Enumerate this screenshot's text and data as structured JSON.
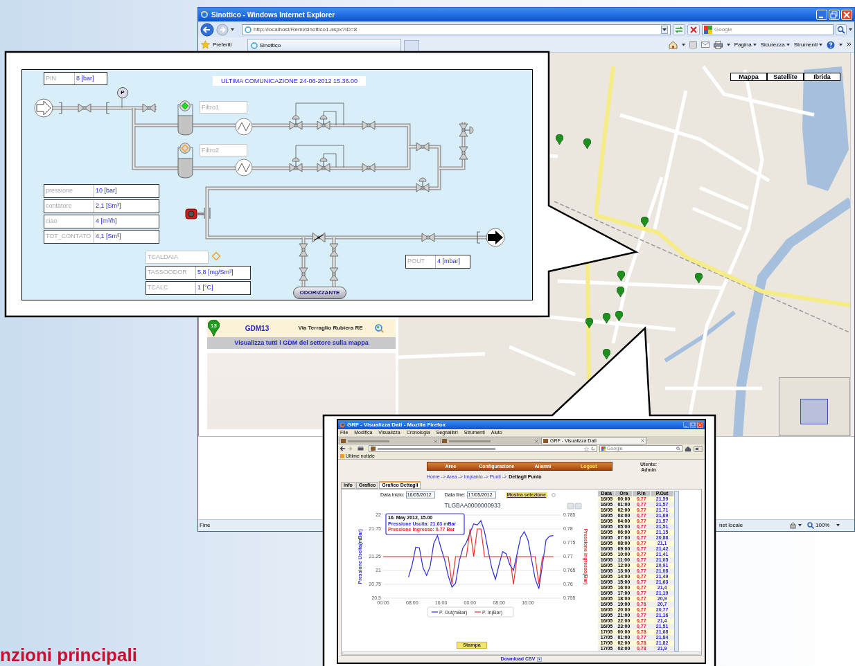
{
  "slide": {
    "heading": "nzioni principali"
  },
  "ie": {
    "title": "Sinottico - Windows Internet Explorer",
    "url": "http://localhost/Remi/sinottico1.aspx?ID=8",
    "search_placeholder": "Google",
    "favorites": "Preferiti",
    "tab": "Sinottico",
    "toolbar": [
      "Pagina",
      "Sicurezza",
      "Strumenti"
    ],
    "status": "Fine",
    "zone": "net locale",
    "zoom": "100%"
  },
  "map": {
    "types": [
      {
        "label": "Mappa"
      },
      {
        "label": "Satellite"
      },
      {
        "label": "Ibrida"
      }
    ]
  },
  "gdm_list": {
    "rows": [
      {
        "marker_number": "13",
        "name": "GDM13",
        "address": "Via Terraglio Rubiera RE"
      }
    ],
    "show_all": "Visualizza tutti i GDM del settore sulla mappa"
  },
  "synoptic": {
    "last_communication": "ULTIMA COMUNICAZIONE 24-06-2012 15.36.00",
    "inlet": {
      "label": "PIN",
      "value": "8 [bar]"
    },
    "gauge": "P",
    "filters": [
      {
        "label": "Filtro1",
        "alarm": false
      },
      {
        "label": "Filtro2",
        "alarm": true
      }
    ],
    "measurements": [
      {
        "label": "pressione",
        "value": "10 [bar]"
      },
      {
        "label": "contatore",
        "value": "2,1 [Sm³]"
      },
      {
        "label": "ciao",
        "value": "4 [m³/h]"
      },
      {
        "label": "TOT_CONTATO",
        "value": "4,1 [Sm³]"
      }
    ],
    "boiler": {
      "label": "TCALDAIA",
      "alarm": true
    },
    "odorant_readings": [
      {
        "label": "TASSOODOR",
        "value": "5,8 [mg/Sm³]"
      },
      {
        "label": "TCALC",
        "value": "1 [°C]"
      }
    ],
    "outlet": {
      "label": "POUT",
      "value": "4 [mbar]"
    },
    "odorizer": "ODORIZZANTE"
  },
  "firefox": {
    "title": "GRF - Visualizza Dati - Mozilla Firefox",
    "menu": [
      "File",
      "Modifica",
      "Visualizza",
      "Cronologia",
      "Segnalibri",
      "Strumenti",
      "Aiuto"
    ],
    "tabs": [
      {
        "selected": false
      },
      {
        "selected": false
      },
      {
        "label": "GRF - Visualizza Dati",
        "selected": true
      }
    ],
    "search_placeholder": "Google",
    "bookmarks": [
      "Ultime notizie"
    ],
    "page": {
      "nav": [
        {
          "label": "Aree",
          "kind": "link"
        },
        {
          "label": "Configurazione",
          "kind": "link"
        },
        {
          "label": "Allarmi",
          "kind": "link"
        },
        {
          "label": "Logout",
          "kind": "logout"
        }
      ],
      "user_label": "Utente:",
      "user": "Admin",
      "breadcrumb": "Home -> Area -> Impianto -> Punti ->",
      "breadcrumb_current": "Dettagli Punto",
      "tabs": [
        {
          "label": "Info",
          "selected": false
        },
        {
          "label": "Grafico",
          "selected": false
        },
        {
          "label": "Grafico Dettagli",
          "selected": true
        }
      ],
      "start_label": "Data inizio:",
      "start": "16/05/2012",
      "end_label": "Data fine:",
      "end": "17/05/2012",
      "show_button": "Mostra selezione",
      "chart": {
        "tooltip": [
          "16. May 2012, 15.00",
          "Pressione Uscita: 21.63 mBar",
          "Pressione Ingresso: 0.77 Bar"
        ],
        "chart_data": {
          "type": "line",
          "title": "TLGBAA0000000933",
          "ylabel": "Pressione Uscita(mBar)",
          "y2label": "Pressione Ingresso(Bar)",
          "x": [
            "2012-05-16 00:00",
            "2012-05-16 01:00",
            "2012-05-16 02:00",
            "2012-05-16 03:00",
            "2012-05-16 04:00",
            "2012-05-16 05:00",
            "2012-05-16 06:00",
            "2012-05-16 07:00",
            "2012-05-16 08:00",
            "2012-05-16 09:00",
            "2012-05-16 10:00",
            "2012-05-16 11:00",
            "2012-05-16 12:00",
            "2012-05-16 13:00",
            "2012-05-16 14:00",
            "2012-05-16 15:00",
            "2012-05-16 16:00",
            "2012-05-16 17:00",
            "2012-05-16 18:00",
            "2012-05-16 19:00",
            "2012-05-16 20:00",
            "2012-05-16 21:00",
            "2012-05-16 22:00",
            "2012-05-16 23:00",
            "2012-05-17 00:00",
            "2012-05-17 01:00",
            "2012-05-17 02:00",
            "2012-05-17 03:00",
            "2012-05-17 04:00",
            "2012-05-17 05:00",
            "2012-05-17 06:00",
            "2012-05-17 07:00",
            "2012-05-17 08:00",
            "2012-05-17 09:00",
            "2012-05-17 10:00",
            "2012-05-17 11:00",
            "2012-05-17 12:00",
            "2012-05-17 13:00",
            "2012-05-17 14:00",
            "2012-05-17 15:00",
            "2012-05-17 16:00",
            "2012-05-17 17:00",
            "2012-05-17 18:00",
            "2012-05-17 19:00",
            "2012-05-17 20:00",
            "2012-05-17 21:00",
            "2012-05-17 22:00",
            "2012-05-17 23:00"
          ],
          "grid": true,
          "legend": true,
          "series": [
            {
              "name": "P. Out(mBar)",
              "color": "#2b2bdb",
              "values": [
                null,
                null,
                null,
                null,
                null,
                null,
                null,
                20.88,
                21.1,
                21.42,
                21.41,
                21.05,
                20.91,
                21.08,
                21.49,
                21.63,
                21.4,
                21.19,
                20.9,
                20.7,
                20.77,
                21.16,
                21.4,
                21.51,
                21.68,
                21.84,
                21.82,
                21.9,
                21.7,
                21.36,
                21.05,
                20.84,
                21.1,
                21.34,
                21.3,
                21.1,
                21.0,
                21.3,
                21.6,
                21.7,
                21.55,
                21.2,
                20.85,
                20.67,
                21.1,
                21.55,
                21.62,
                21.63
              ]
            },
            {
              "name": "P. In(Bar)",
              "color": "#e53030",
              "axis": "y2",
              "values": [
                0.77,
                0.77,
                0.77,
                0.77,
                0.77,
                0.77,
                0.77,
                0.77,
                0.77,
                0.77,
                0.77,
                0.77,
                0.77,
                0.77,
                0.77,
                0.77,
                0.77,
                0.77,
                0.77,
                0.76,
                0.77,
                0.77,
                0.77,
                0.77,
                0.78,
                0.77,
                0.78,
                0.78,
                0.77,
                0.77,
                0.77,
                0.77,
                0.77,
                0.77,
                0.77,
                0.77,
                0.76,
                0.77,
                0.77,
                0.77,
                0.77,
                0.77,
                0.77,
                0.76,
                0.77,
                0.77,
                0.77,
                0.77
              ]
            }
          ],
          "xlim": [
            "2012-05-16 00:00",
            "2012-05-18 01:00"
          ],
          "xticks": [
            {
              "value": "2012-05-16 00:00",
              "label": "00:00"
            },
            {
              "value": "2012-05-16 08:00",
              "label": "08:00"
            },
            {
              "value": "2012-05-16 16:00",
              "label": "16:00"
            },
            {
              "value": "2012-05-17 00:00",
              "label": "00:00"
            },
            {
              "value": "2012-05-17 08:00",
              "label": "08:00"
            },
            {
              "value": "2012-05-17 16:00",
              "label": "16:00"
            }
          ],
          "ylim": [
            20.5,
            22
          ],
          "yticks": [
            20.5,
            20.75,
            21,
            21.25,
            21.75,
            22
          ],
          "y2lim": [
            0.755,
            0.785
          ],
          "y2ticks": [
            0.755,
            0.76,
            0.765,
            0.77,
            0.775,
            0.78,
            0.785
          ]
        }
      },
      "table": {
        "columns": [
          "Data",
          "Ora",
          "P.In",
          "P.Out"
        ],
        "rows": [
          [
            "16/05",
            "00:00",
            "0,77",
            "21,59"
          ],
          [
            "16/05",
            "01:00",
            "0,77",
            "21,57"
          ],
          [
            "16/05",
            "02:00",
            "0,77",
            "21,71"
          ],
          [
            "16/05",
            "03:00",
            "0,77",
            "21,69"
          ],
          [
            "16/05",
            "04:00",
            "0,77",
            "21,57"
          ],
          [
            "16/05",
            "05:00",
            "0,77",
            "21,51"
          ],
          [
            "16/05",
            "06:00",
            "0,77",
            "21,15"
          ],
          [
            "16/05",
            "07:00",
            "0,77",
            "20,88"
          ],
          [
            "16/05",
            "08:00",
            "0,77",
            "21,1"
          ],
          [
            "16/05",
            "09:00",
            "0,77",
            "21,42"
          ],
          [
            "16/05",
            "10:00",
            "0,77",
            "21,41"
          ],
          [
            "16/05",
            "11:00",
            "0,77",
            "21,05"
          ],
          [
            "16/05",
            "12:00",
            "0,77",
            "20,91"
          ],
          [
            "16/05",
            "13:00",
            "0,77",
            "21,08"
          ],
          [
            "16/05",
            "14:00",
            "0,77",
            "21,49"
          ],
          [
            "16/05",
            "15:00",
            "0,77",
            "21,63"
          ],
          [
            "16/05",
            "16:00",
            "0,77",
            "21,4"
          ],
          [
            "16/05",
            "17:00",
            "0,77",
            "21,19"
          ],
          [
            "16/05",
            "18:00",
            "0,77",
            "20,9"
          ],
          [
            "16/05",
            "19:00",
            "0,76",
            "20,7"
          ],
          [
            "16/05",
            "20:00",
            "0,77",
            "20,77"
          ],
          [
            "16/05",
            "21:00",
            "0,77",
            "21,16"
          ],
          [
            "16/05",
            "22:00",
            "0,77",
            "21,4"
          ],
          [
            "16/05",
            "23:00",
            "0,77",
            "21,51"
          ],
          [
            "17/05",
            "00:00",
            "0,78",
            "21,68"
          ],
          [
            "17/05",
            "01:00",
            "0,77",
            "21,84"
          ],
          [
            "17/05",
            "02:00",
            "0,78",
            "21,82"
          ],
          [
            "17/05",
            "03:00",
            "0,78",
            "21,9"
          ]
        ]
      },
      "print_button": "Stampa",
      "download": "Download CSV"
    }
  }
}
